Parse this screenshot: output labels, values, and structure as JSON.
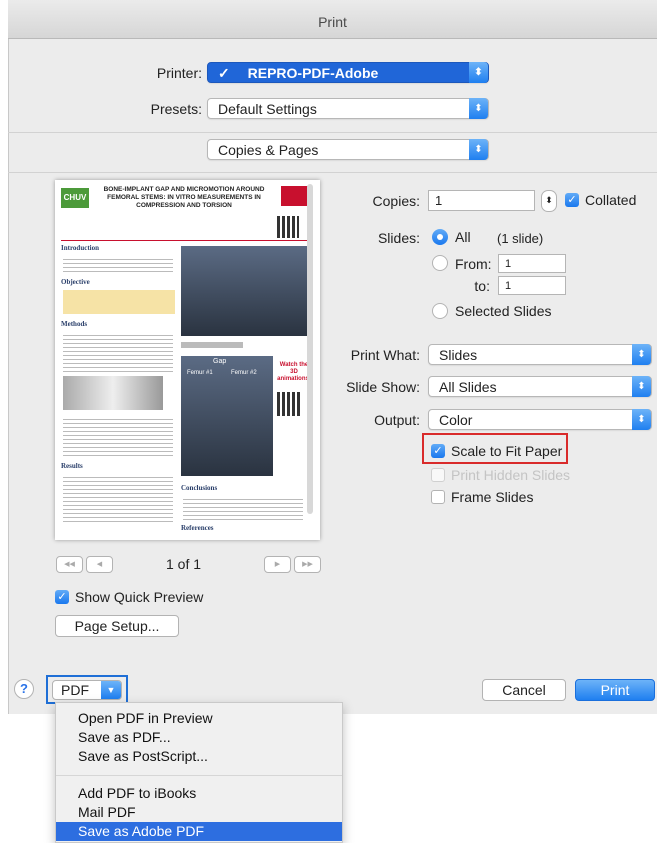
{
  "dialog": {
    "title": "Print"
  },
  "printer": {
    "label": "Printer:",
    "value": "REPRO-PDF-Adobe",
    "check": "✓"
  },
  "presets": {
    "label": "Presets:",
    "value": "Default Settings"
  },
  "section": {
    "value": "Copies & Pages"
  },
  "copies": {
    "label": "Copies:",
    "value": "1",
    "collated_label": "Collated",
    "collated": true
  },
  "slides": {
    "label": "Slides:",
    "all_label": "All",
    "all_count": "(1 slide)",
    "from_label": "From:",
    "from_value": "1",
    "to_label": "to:",
    "to_value": "1",
    "selected_label": "Selected Slides"
  },
  "print_what": {
    "label": "Print What:",
    "value": "Slides"
  },
  "slide_show": {
    "label": "Slide Show:",
    "value": "All Slides"
  },
  "output": {
    "label": "Output:",
    "value": "Color"
  },
  "options": {
    "scale_label": "Scale to Fit Paper",
    "hidden_label": "Print Hidden Slides",
    "frame_label": "Frame Slides"
  },
  "preview": {
    "page_indicator": "1 of 1",
    "first": "◀◀",
    "prev": "◀",
    "next": "▶",
    "last": "▶▶",
    "poster": {
      "logo": "CHUV",
      "title": "BONE-IMPLANT GAP AND MICROMOTION AROUND FEMORAL STEMS: IN VITRO MEASUREMENTS IN COMPRESSION AND TORSION",
      "sections": [
        "Introduction",
        "Objective",
        "Methods",
        "Results",
        "Conclusions",
        "References"
      ],
      "chart_heads": [
        "Gap",
        "Femur #1",
        "Femur #2"
      ],
      "callout": "Watch the 3D animations!"
    }
  },
  "quick_preview": {
    "label": "Show Quick Preview"
  },
  "page_setup": {
    "label": "Page Setup..."
  },
  "footer": {
    "help": "?",
    "pdf": "PDF",
    "cancel": "Cancel",
    "print": "Print"
  },
  "pdf_menu": {
    "items": [
      "Open PDF in Preview",
      "Save as PDF...",
      "Save as PostScript...",
      "Add PDF to iBooks",
      "Mail PDF",
      "Save as Adobe PDF"
    ]
  },
  "colors": {
    "accent": "#1a78ee",
    "highlight_box": "#d92b2b",
    "pdf_box": "#1f6fd6"
  }
}
